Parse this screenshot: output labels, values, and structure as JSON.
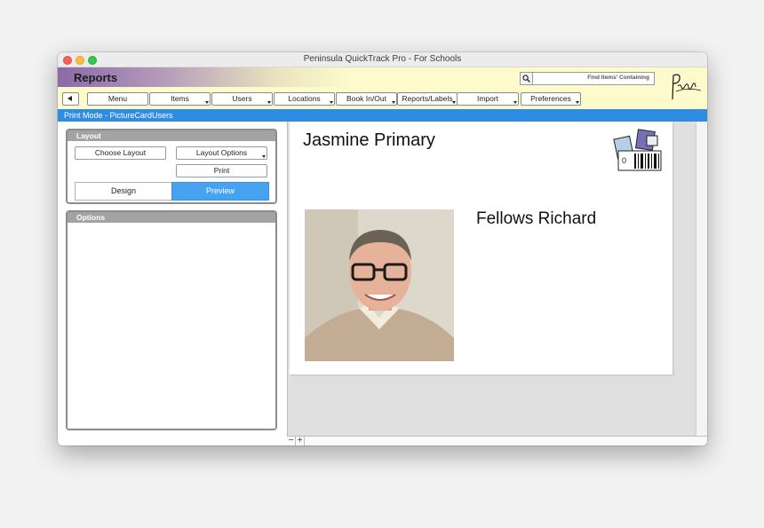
{
  "window": {
    "title": "Peninsula QuickTrack Pro - For Schools"
  },
  "header": {
    "title": "Reports",
    "find_label": "Find Items' Containing",
    "logo_text": "Peninsula"
  },
  "menubar": {
    "items": [
      {
        "label": "Menu",
        "has_arrow": false
      },
      {
        "label": "Items",
        "has_arrow": true
      },
      {
        "label": "Users",
        "has_arrow": true
      },
      {
        "label": "Locations",
        "has_arrow": true
      },
      {
        "label": "Book In/Out",
        "has_arrow": true
      },
      {
        "label": "Reports/Labels",
        "has_arrow": true
      },
      {
        "label": "Import",
        "has_arrow": true
      },
      {
        "label": "Preferences",
        "has_arrow": true
      }
    ]
  },
  "mode_bar": {
    "text": "Print Mode - PictureCardUsers"
  },
  "layout_panel": {
    "title": "Layout",
    "choose_layout": "Choose Layout",
    "layout_options": "Layout Options",
    "print": "Print",
    "design": "Design",
    "preview": "Preview",
    "active_mode": "Preview"
  },
  "options_panel": {
    "title": "Options"
  },
  "card": {
    "school": "Jasmine Primary",
    "person_name": "Fellows Richard",
    "icon_counter": "0"
  },
  "zoom": {
    "out": "−",
    "in": "+"
  },
  "colors": {
    "accent": "#2e8de3",
    "header_bg": "#fdfbcb",
    "segment_active": "#47a3f2"
  }
}
